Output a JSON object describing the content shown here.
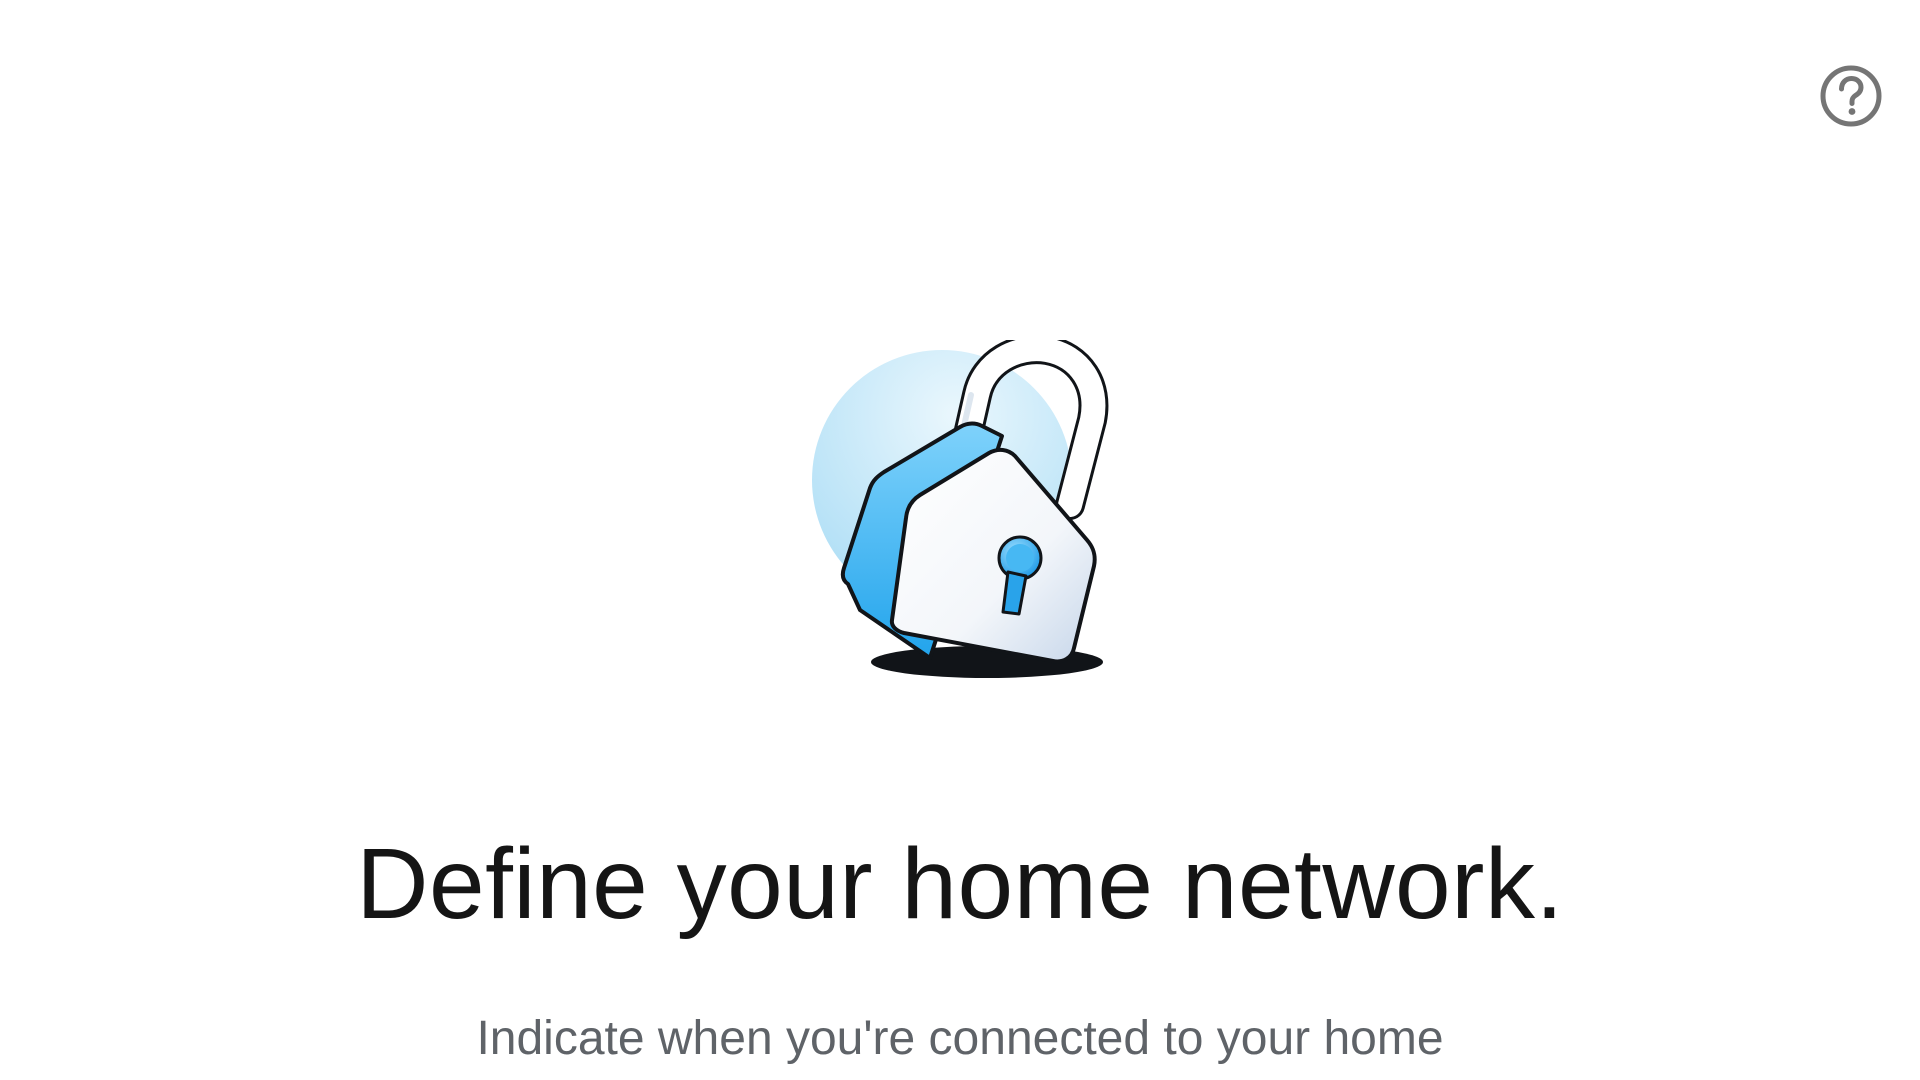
{
  "header": {
    "help_icon": "help-circle-icon",
    "help_icon_color": "#757575"
  },
  "hero": {
    "illustration": "padlock-icon",
    "accent_color": "#3ab0f0",
    "circle_color": "#c7ebfa"
  },
  "content": {
    "title": "Define your home network.",
    "subtitle": "Indicate when you're connected to your home"
  }
}
